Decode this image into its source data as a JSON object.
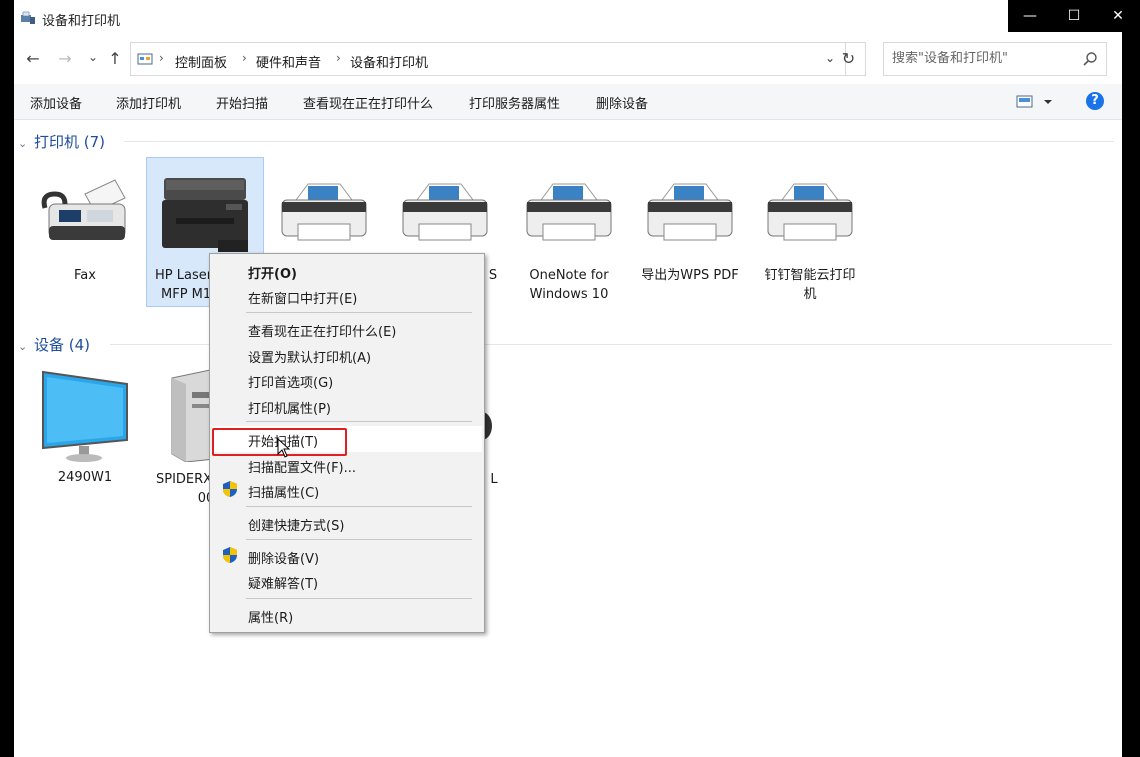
{
  "window": {
    "title": "设备和打印机",
    "controls": {
      "minimize": "—",
      "maximize": "☐",
      "close": "✕"
    }
  },
  "nav": {
    "back": "←",
    "forward": "→",
    "recent": "⌄",
    "up": "↑",
    "breadcrumb": [
      "控制面板",
      "硬件和声音",
      "设备和打印机"
    ],
    "refresh": "↻"
  },
  "search": {
    "placeholder": "搜索\"设备和打印机\""
  },
  "toolbar": {
    "items": [
      "添加设备",
      "添加打印机",
      "开始扫描",
      "查看现在正在打印什么",
      "打印服务器属性",
      "删除设备"
    ],
    "help": "?"
  },
  "printers": {
    "header": "打印机 (7)",
    "items": [
      {
        "label": "Fax"
      },
      {
        "label": "HP Laser",
        "label2": "MFP M1"
      },
      {
        "label": ""
      },
      {
        "label": "S"
      },
      {
        "label": "OneNote for",
        "label2": "Windows 10"
      },
      {
        "label": "导出为WPS PDF"
      },
      {
        "label": "钉钉智能云打印",
        "label2": "机"
      }
    ]
  },
  "devices": {
    "header": "设备 (4)",
    "items": [
      {
        "label": "2490W1"
      },
      {
        "label": "SPIDERX",
        "label2": "00"
      },
      {
        "label": "L"
      }
    ]
  },
  "context_menu": {
    "items": [
      {
        "label": "打开(O)",
        "bold": true
      },
      {
        "label": "在新窗口中打开(E)"
      },
      {
        "label": "查看现在正在打印什么(E)"
      },
      {
        "label": "设置为默认打印机(A)"
      },
      {
        "label": "打印首选项(G)"
      },
      {
        "label": "打印机属性(P)"
      },
      {
        "label": "开始扫描(T)",
        "highlighted": true
      },
      {
        "label": "扫描配置文件(F)..."
      },
      {
        "label": "扫描属性(C)",
        "shield": true
      },
      {
        "label": "创建快捷方式(S)"
      },
      {
        "label": "删除设备(V)",
        "shield": true
      },
      {
        "label": "疑难解答(T)"
      },
      {
        "label": "属性(R)"
      }
    ]
  },
  "colors": {
    "highlight_box": "#e02020",
    "selection": "#d6e8fa",
    "header_text": "#1e4e9a"
  }
}
